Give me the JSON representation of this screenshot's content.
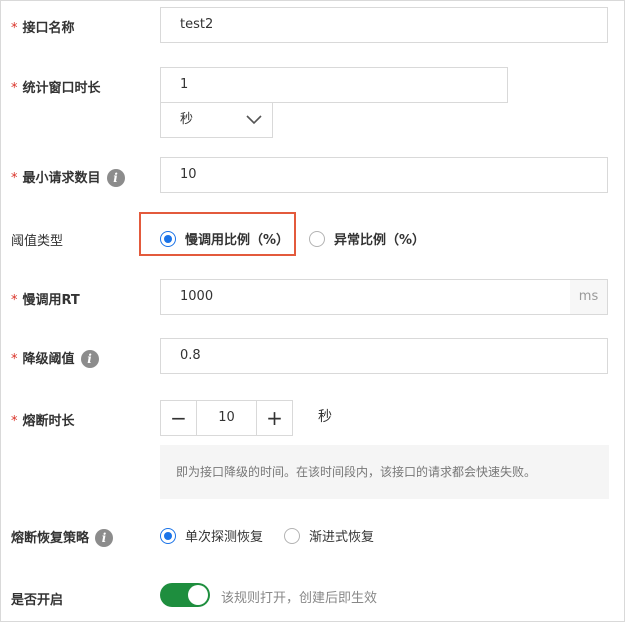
{
  "form": {
    "api_name": {
      "label": "接口名称",
      "required": "*",
      "value": "test2"
    },
    "stat_window": {
      "label": "统计窗口时长",
      "required": "*",
      "value": "1",
      "unit_select": "秒"
    },
    "min_requests": {
      "label": "最小请求数目",
      "required": "*",
      "value": "10",
      "info_icon": "i"
    },
    "threshold_type": {
      "label": "阈值类型",
      "options": [
        {
          "label": "慢调用比例（%）",
          "selected": true
        },
        {
          "label": "异常比例（%）",
          "selected": false
        }
      ]
    },
    "slow_rt": {
      "label": "慢调用RT",
      "required": "*",
      "value": "1000",
      "suffix": "ms"
    },
    "degrade_threshold": {
      "label": "降级阈值",
      "required": "*",
      "value": "0.8",
      "info_icon": "i"
    },
    "break_duration": {
      "label": "熔断时长",
      "required": "*",
      "value": "10",
      "minus": "−",
      "plus": "+",
      "unit": "秒",
      "hint": "即为接口降级的时间。在该时间段内，该接口的请求都会快速失败。"
    },
    "recovery_strategy": {
      "label": "熔断恢复策略",
      "info_icon": "i",
      "options": [
        {
          "label": "单次探测恢复",
          "selected": true
        },
        {
          "label": "渐进式恢复",
          "selected": false
        }
      ]
    },
    "enabled": {
      "label": "是否开启",
      "on": true,
      "note": "该规则打开，创建后即生效"
    }
  },
  "colors": {
    "accent": "#1a73e8",
    "required": "#d93026",
    "highlight": "#e35a3c",
    "toggle_on": "#1e8e3e"
  },
  "icons": [
    "info-icon",
    "chevron-down-icon",
    "radio-icon",
    "minus-icon",
    "plus-icon",
    "toggle-switch-icon"
  ]
}
